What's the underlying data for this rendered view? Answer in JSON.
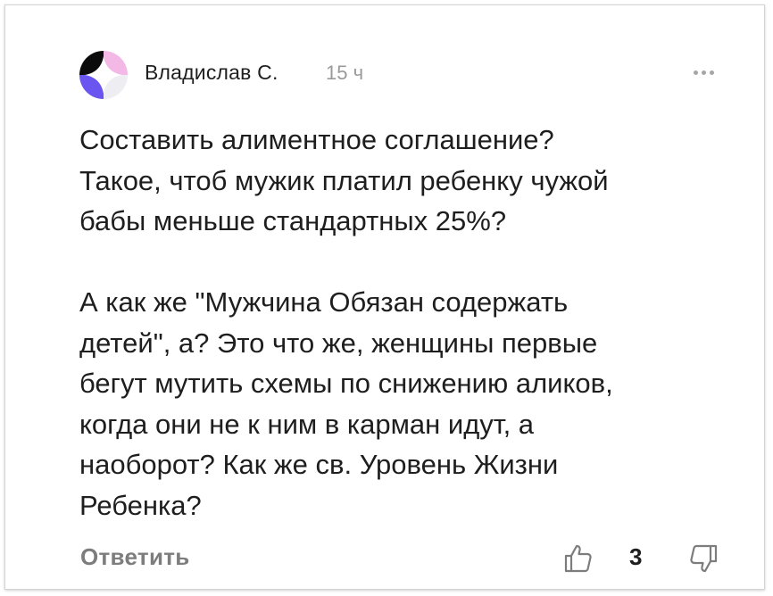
{
  "comment": {
    "author": "Владислав С.",
    "time": "15 ч",
    "paragraphs": [
      "Составить алиментное соглашение?\nТакое, чтоб мужик платил ребенку чужой\nбабы меньше стандартных 25%?",
      "А как же \"Мужчина Обязан содержать\nдетей\", а? Это что же, женщины первые\nбегут мутить схемы по снижению аликов,\nкогда они не к ним в карман идут, а\nнаоборот? Как же св. Уровень Жизни\nРебенка?"
    ],
    "reply_label": "Ответить",
    "like_count": "3"
  },
  "icons": {
    "avatar": "avatar-icon",
    "more": "more-dots-icon",
    "like": "thumbs-up-icon",
    "dislike": "thumbs-down-icon"
  },
  "colors": {
    "avatar_black": "#0b0b0b",
    "avatar_pink": "#f3b8e6",
    "avatar_purple": "#6a55f0",
    "avatar_light": "#ededf2",
    "muted": "#7d7d7d"
  }
}
